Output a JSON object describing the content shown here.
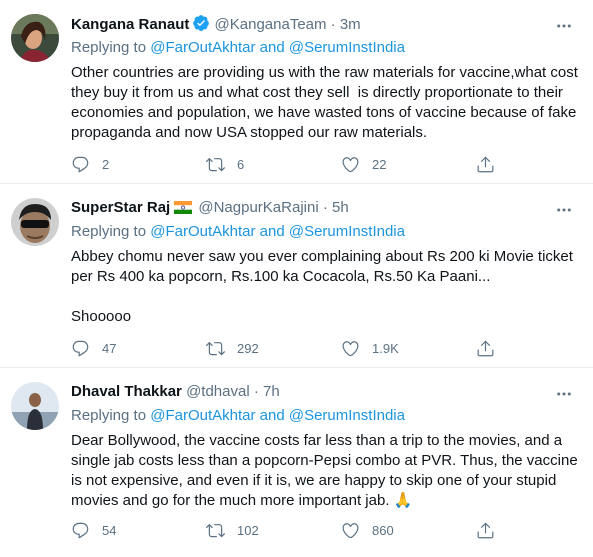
{
  "tweets": [
    {
      "name": "Kangana Ranaut",
      "handle": "@KanganaTeam",
      "dot": "·",
      "time": "3m",
      "verified": true,
      "replying_prefix": "Replying to ",
      "mention1": "@FarOutAkhtar",
      "and": " and ",
      "mention2": "@SerumInstIndia",
      "text": "Other countries are providing us with the raw materials for vaccine,what cost they buy it from us and what cost they sell  is directly proportionate to their economies and population, we have wasted tons of vaccine because of fake propaganda and now USA stopped our raw materials.",
      "replies": "2",
      "retweets": "6",
      "likes": "22"
    },
    {
      "name": "SuperStar Raj",
      "flag": "🇮🇳",
      "handle": "@NagpurKaRajini",
      "dot": "·",
      "time": "5h",
      "replying_prefix": "Replying to ",
      "mention1": "@FarOutAkhtar",
      "and": " and ",
      "mention2": "@SerumInstIndia",
      "text": "Abbey chomu never saw you ever complaining about Rs 200 ki Movie ticket per Rs 400 ka popcorn, Rs.100 ka Cocacola, Rs.50 Ka Paani...\n\nShooooo",
      "replies": "47",
      "retweets": "292",
      "likes": "1.9K"
    },
    {
      "name": "Dhaval Thakkar",
      "handle": "@tdhaval",
      "dot": "·",
      "time": "7h",
      "replying_prefix": "Replying to ",
      "mention1": "@FarOutAkhtar",
      "and": " and ",
      "mention2": "@SerumInstIndia",
      "text": "Dear Bollywood, the vaccine costs far less than a trip to the movies, and a single jab costs less than a popcorn-Pepsi combo at PVR. Thus, the vaccine is not expensive, and even if it is, we are happy to skip one of your stupid movies and go for the much more important jab. 🙏",
      "replies": "54",
      "retweets": "102",
      "likes": "860"
    }
  ],
  "icons": [
    "verified-badge-icon",
    "more-options-icon",
    "reply-icon",
    "retweet-icon",
    "like-icon",
    "share-icon"
  ],
  "colors": {
    "accent": "#1b95e0",
    "verified": "#1da1f2",
    "muted": "#5b7083",
    "divider": "#e6ecf0"
  }
}
